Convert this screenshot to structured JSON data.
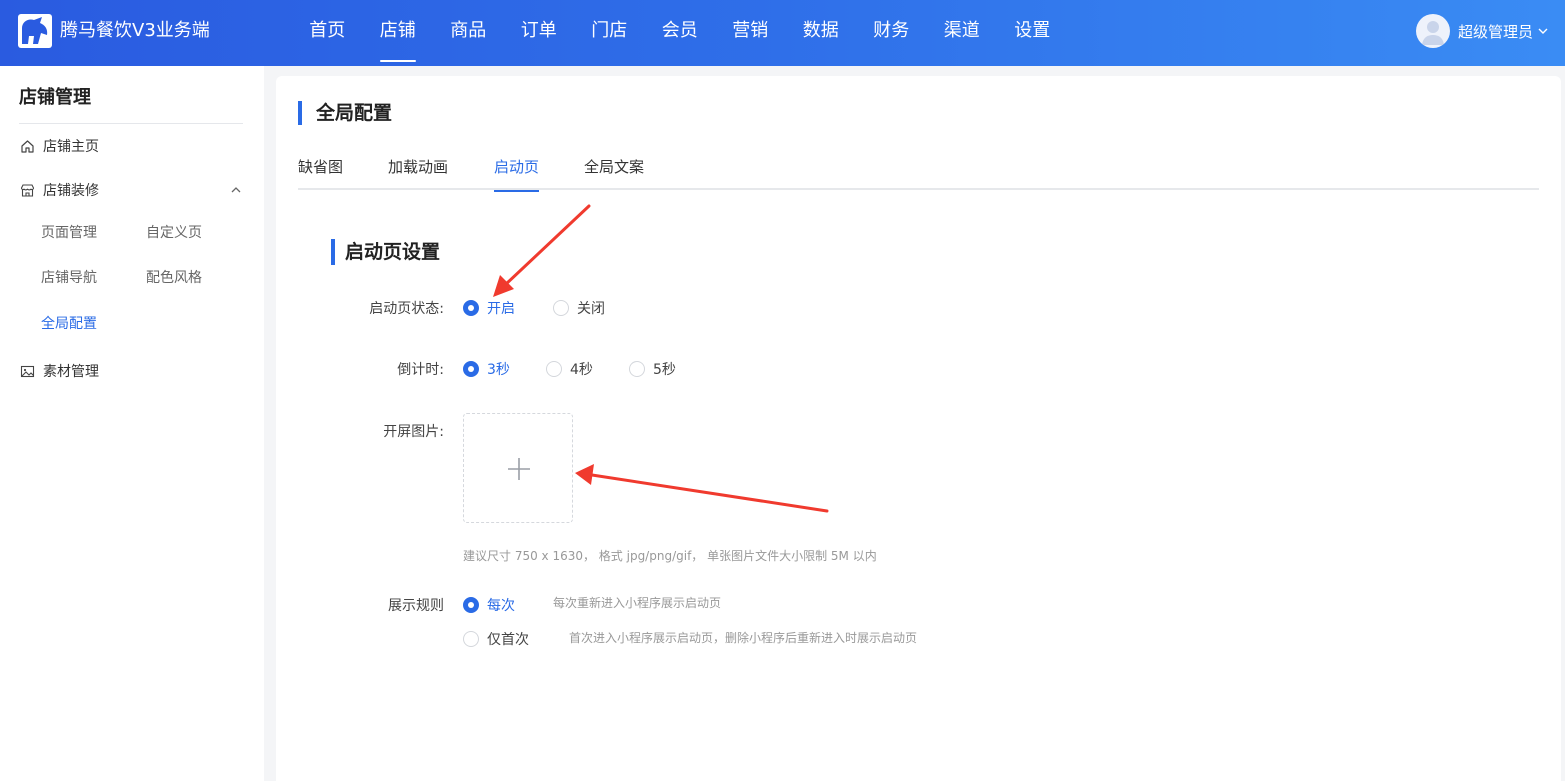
{
  "app": {
    "title": "腾马餐饮V3业务端"
  },
  "nav": {
    "items": [
      "首页",
      "店铺",
      "商品",
      "订单",
      "门店",
      "会员",
      "营销",
      "数据",
      "财务",
      "渠道",
      "设置"
    ],
    "active": "店铺"
  },
  "user": {
    "name": "超级管理员"
  },
  "sidebar": {
    "title": "店铺管理",
    "home": "店铺主页",
    "decor": "店铺装修",
    "decor_items": [
      "页面管理",
      "自定义页",
      "店铺导航",
      "配色风格",
      "全局配置"
    ],
    "decor_active": "全局配置",
    "material": "素材管理"
  },
  "main": {
    "title": "全局配置",
    "tabs": [
      "缺省图",
      "加载动画",
      "启动页",
      "全局文案"
    ],
    "active_tab": "启动页",
    "section_title": "启动页设置",
    "status": {
      "label": "启动页状态:",
      "options": [
        "开启",
        "关闭"
      ],
      "selected": "开启"
    },
    "countdown": {
      "label": "倒计时:",
      "options": [
        "3秒",
        "4秒",
        "5秒"
      ],
      "selected": "3秒"
    },
    "image": {
      "label": "开屏图片:",
      "hint": "建议尺寸 750 x 1630， 格式 jpg/png/gif， 单张图片文件大小限制 5M 以内"
    },
    "rule": {
      "label": "展示规则",
      "options": [
        {
          "label": "每次",
          "desc": "每次重新进入小程序展示启动页"
        },
        {
          "label": "仅首次",
          "desc": "首次进入小程序展示启动页，删除小程序后重新进入时展示启动页"
        }
      ],
      "selected": "每次"
    }
  },
  "colors": {
    "primary": "#2a6be6",
    "header_start": "#2a5be0",
    "header_end": "#3a8cf4",
    "annotation": "#f03a2e"
  },
  "icons": [
    "logo-icon",
    "avatar-icon",
    "chevron-down-icon",
    "home-icon",
    "store-icon",
    "chevron-up-icon",
    "image-icon",
    "plus-icon",
    "annotation-arrow"
  ]
}
